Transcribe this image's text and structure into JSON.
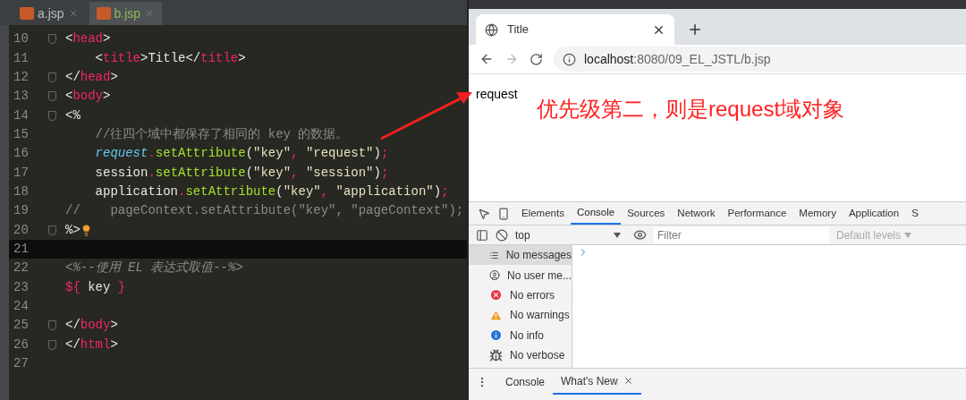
{
  "editor": {
    "tabs": [
      {
        "label": "a.jsp",
        "selected": false
      },
      {
        "label": "b.jsp",
        "selected": true
      }
    ],
    "lines": [
      {
        "number": "10",
        "fold": true,
        "current": false,
        "tokens": [
          {
            "kind": "plain",
            "text": "<"
          },
          {
            "kind": "tag",
            "text": "head"
          },
          {
            "kind": "plain",
            "text": ">"
          }
        ]
      },
      {
        "number": "11",
        "fold": false,
        "current": false,
        "tokens": [
          {
            "kind": "plain",
            "text": "    <"
          },
          {
            "kind": "tag",
            "text": "title"
          },
          {
            "kind": "plain",
            "text": ">Title</"
          },
          {
            "kind": "tag",
            "text": "title"
          },
          {
            "kind": "plain",
            "text": ">"
          }
        ]
      },
      {
        "number": "12",
        "fold": true,
        "current": false,
        "tokens": [
          {
            "kind": "plain",
            "text": "</"
          },
          {
            "kind": "tag",
            "text": "head"
          },
          {
            "kind": "plain",
            "text": ">"
          }
        ]
      },
      {
        "number": "13",
        "fold": true,
        "current": false,
        "tokens": [
          {
            "kind": "plain",
            "text": "<"
          },
          {
            "kind": "tag",
            "text": "body"
          },
          {
            "kind": "plain",
            "text": ">"
          }
        ]
      },
      {
        "number": "14",
        "fold": true,
        "current": false,
        "tokens": [
          {
            "kind": "plain",
            "text": "<%"
          }
        ]
      },
      {
        "number": "15",
        "fold": false,
        "current": false,
        "tokens": [
          {
            "kind": "comment",
            "text": "    //往四个域中都保存了相同的 key 的数据。"
          }
        ]
      },
      {
        "number": "16",
        "fold": false,
        "current": false,
        "tokens": [
          {
            "kind": "implicit",
            "text": "    request"
          },
          {
            "kind": "op",
            "text": "."
          },
          {
            "kind": "method",
            "text": "setAttribute"
          },
          {
            "kind": "plain",
            "text": "("
          },
          {
            "kind": "string",
            "text": "\"key\""
          },
          {
            "kind": "op",
            "text": ", "
          },
          {
            "kind": "string",
            "text": "\"request\""
          },
          {
            "kind": "plain",
            "text": ")"
          },
          {
            "kind": "op",
            "text": ";"
          }
        ]
      },
      {
        "number": "17",
        "fold": false,
        "current": false,
        "tokens": [
          {
            "kind": "plain",
            "text": "    session"
          },
          {
            "kind": "op",
            "text": "."
          },
          {
            "kind": "method",
            "text": "setAttribute"
          },
          {
            "kind": "plain",
            "text": "("
          },
          {
            "kind": "string",
            "text": "\"key\""
          },
          {
            "kind": "op",
            "text": ", "
          },
          {
            "kind": "string",
            "text": "\"session\""
          },
          {
            "kind": "plain",
            "text": ")"
          },
          {
            "kind": "op",
            "text": ";"
          }
        ]
      },
      {
        "number": "18",
        "fold": false,
        "current": false,
        "tokens": [
          {
            "kind": "plain",
            "text": "    application"
          },
          {
            "kind": "op",
            "text": "."
          },
          {
            "kind": "method",
            "text": "setAttribute"
          },
          {
            "kind": "plain",
            "text": "("
          },
          {
            "kind": "string",
            "text": "\"key\""
          },
          {
            "kind": "op",
            "text": ", "
          },
          {
            "kind": "string",
            "text": "\"application\""
          },
          {
            "kind": "plain",
            "text": ")"
          },
          {
            "kind": "op",
            "text": ";"
          }
        ]
      },
      {
        "number": "19",
        "fold": false,
        "current": false,
        "tokens": [
          {
            "kind": "comment",
            "text": "//    pageContext.setAttribute(\"key\", \"pageContext\");"
          }
        ]
      },
      {
        "number": "20",
        "fold": true,
        "current": false,
        "tokens": [
          {
            "kind": "plain",
            "text": "%>"
          }
        ]
      },
      {
        "number": "21",
        "fold": false,
        "current": true
      },
      {
        "number": "22",
        "fold": false,
        "current": false,
        "tokens": [
          {
            "kind": "el_comment",
            "text": "<%--使用 EL 表达式取值--%>"
          }
        ]
      },
      {
        "number": "23",
        "fold": false,
        "current": false,
        "tokens": [
          {
            "kind": "el",
            "text": "${"
          },
          {
            "kind": "plain",
            "text": " key "
          },
          {
            "kind": "el",
            "text": "}"
          }
        ]
      },
      {
        "number": "24",
        "fold": false,
        "current": false
      },
      {
        "number": "25",
        "fold": true,
        "current": false,
        "tokens": [
          {
            "kind": "plain",
            "text": "</"
          },
          {
            "kind": "tag",
            "text": "body"
          },
          {
            "kind": "plain",
            "text": ">"
          }
        ]
      },
      {
        "number": "26",
        "fold": true,
        "current": false,
        "tokens": [
          {
            "kind": "plain",
            "text": "</"
          },
          {
            "kind": "tag",
            "text": "html"
          },
          {
            "kind": "plain",
            "text": ">"
          }
        ]
      },
      {
        "number": "27",
        "fold": false,
        "current": false
      }
    ]
  },
  "browser": {
    "tab_title": "Title",
    "url_host": "localhost",
    "url_rest": ":8080/09_EL_JSTL/b.jsp",
    "page_text": "request"
  },
  "annotation": "优先级第二，则是request域对象",
  "devtools": {
    "tabs": [
      {
        "label": "Elements",
        "selected": false
      },
      {
        "label": "Console",
        "selected": true
      },
      {
        "label": "Sources",
        "selected": false
      },
      {
        "label": "Network",
        "selected": false
      },
      {
        "label": "Performance",
        "selected": false
      },
      {
        "label": "Memory",
        "selected": false
      },
      {
        "label": "Application",
        "selected": false
      },
      {
        "label": "S",
        "selected": false
      }
    ],
    "context": "top",
    "filter_placeholder": "Filter",
    "levels": "Default levels",
    "sidebar": [
      {
        "kind": "messages",
        "label": "No messages",
        "selected": true
      },
      {
        "kind": "user",
        "label": "No user me...",
        "selected": false
      },
      {
        "kind": "errors",
        "label": "No errors",
        "selected": false
      },
      {
        "kind": "warnings",
        "label": "No warnings",
        "selected": false
      },
      {
        "kind": "info",
        "label": "No info",
        "selected": false
      },
      {
        "kind": "verbose",
        "label": "No verbose",
        "selected": false
      }
    ],
    "drawer_tabs": [
      {
        "label": "Console",
        "selected": false
      },
      {
        "label": "What's New",
        "selected": true
      }
    ]
  }
}
